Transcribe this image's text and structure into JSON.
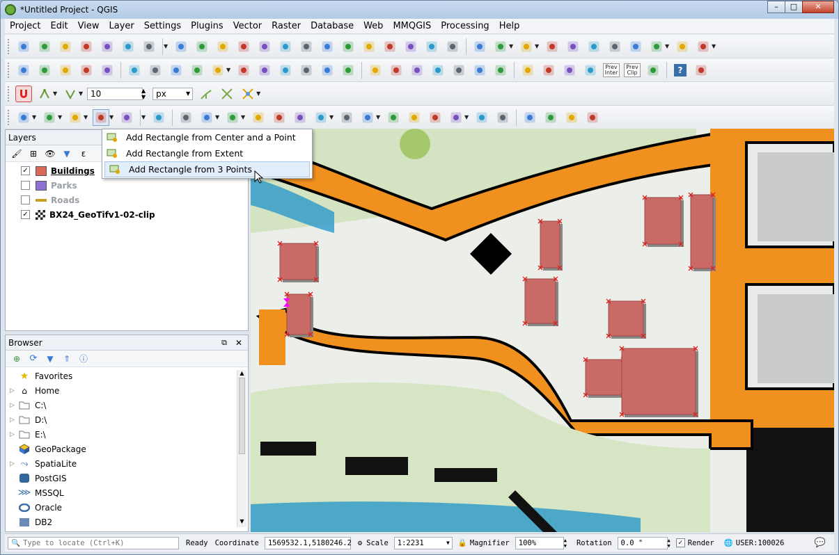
{
  "window": {
    "title": "*Untitled Project - QGIS",
    "minimize": "–",
    "maximize": "□",
    "close": "✕"
  },
  "menu": [
    "Project",
    "Edit",
    "View",
    "Layer",
    "Settings",
    "Plugins",
    "Vector",
    "Raster",
    "Database",
    "Web",
    "MMQGIS",
    "Processing",
    "Help"
  ],
  "toolbar3": {
    "tolerance_value": "10",
    "unit": "px"
  },
  "toolbar1_icons": [
    "new-project",
    "open-project",
    "save-project",
    "save-as",
    "new-print-layout",
    "layout-manager",
    "style-manager",
    "pan",
    "pan-to-selection",
    "zoom-in",
    "zoom-out",
    "zoom-native",
    "zoom-full",
    "zoom-to-selection",
    "zoom-to-layer",
    "zoom-last",
    "zoom-next",
    "new-map-view",
    "new-bookmark",
    "show-bookmarks",
    "refresh",
    "identify",
    "map-tips",
    "select-features",
    "select-by-value",
    "deselect",
    "attribute-table",
    "statistics",
    "field-calculator",
    "measure",
    "annotation",
    "text-annotation"
  ],
  "toolbar2_icons": [
    "data-source-manager",
    "new-geopackage-layer",
    "digitize",
    "current-edits",
    "toggle-editing",
    "save-layer-edits",
    "add-feature",
    "move-feature",
    "vertex-tool",
    "modify-attributes",
    "delete-selected",
    "cut-features",
    "copy-features",
    "paste-features",
    "undo",
    "redo",
    "label-tool",
    "pin-labels",
    "highlight-pinned",
    "move-label",
    "rotate-label",
    "change-label",
    "show-hide-labels",
    "lifebuoy",
    "tracking",
    "python-console",
    "styling",
    "prev-inter",
    "prev-clip",
    "printer",
    "help",
    "crs"
  ],
  "prev_inter_label": "Prev Inter",
  "prev_clip_label": "Prev Clip",
  "toolbar4_icons": [
    "add-circular-string",
    "add-circle",
    "add-ellipse",
    "add-rectangle",
    "add-regular-polygon",
    "digitize-georef",
    "add-ring",
    "add-part",
    "fill-ring",
    "delete-ring",
    "delete-part",
    "reshape",
    "offset-curve",
    "split-features",
    "split-parts",
    "merge-features",
    "merge-attributes",
    "rotate-point-symbols",
    "offset-point-symbols",
    "simplify",
    "curve-j",
    "curve-d",
    "curve-j2",
    "move",
    "bezier"
  ],
  "popup": {
    "items": [
      {
        "label": "Add Rectangle from Center and a Point"
      },
      {
        "label": "Add Rectangle from Extent"
      },
      {
        "label": "Add Rectangle from 3 Points"
      }
    ]
  },
  "layers_panel": {
    "title": "Layers",
    "layers": [
      {
        "name": "Buildings",
        "checked": true,
        "color": "#d9685a",
        "bold": true,
        "underline": true,
        "enabled": true
      },
      {
        "name": "Parks",
        "checked": false,
        "color": "#8e6fd6",
        "bold": true,
        "underline": false,
        "enabled": false
      },
      {
        "name": "Roads",
        "checked": false,
        "color": "#c8a020",
        "bold": true,
        "underline": false,
        "enabled": false
      },
      {
        "name": "BX24_GeoTifv1-02-clip",
        "checked": true,
        "color": "#3a6ea8",
        "bold": true,
        "underline": false,
        "enabled": true
      }
    ]
  },
  "browser_panel": {
    "title": "Browser",
    "float_icon": "⧉",
    "close_icon": "✕",
    "items": [
      {
        "name": "Favorites",
        "icon": "star-icon",
        "arrow": false
      },
      {
        "name": "Home",
        "icon": "home-icon",
        "arrow": true
      },
      {
        "name": "C:\\",
        "icon": "folder-icon",
        "arrow": true
      },
      {
        "name": "D:\\",
        "icon": "folder-icon",
        "arrow": true
      },
      {
        "name": "E:\\",
        "icon": "folder-icon",
        "arrow": true
      },
      {
        "name": "GeoPackage",
        "icon": "geopackage-icon",
        "arrow": false
      },
      {
        "name": "SpatiaLite",
        "icon": "spatialite-icon",
        "arrow": true
      },
      {
        "name": "PostGIS",
        "icon": "postgis-icon",
        "arrow": false
      },
      {
        "name": "MSSQL",
        "icon": "mssql-icon",
        "arrow": false
      },
      {
        "name": "Oracle",
        "icon": "oracle-icon",
        "arrow": false
      },
      {
        "name": "DB2",
        "icon": "db2-icon",
        "arrow": false
      }
    ]
  },
  "status": {
    "locate_placeholder": "Type to locate (Ctrl+K)",
    "ready": "Ready",
    "coordinate_label": "Coordinate",
    "coordinate_value": "1569532.1,5180246.2",
    "scale_label": "Scale",
    "scale_value": "1:2231",
    "magnifier_label": "Magnifier",
    "magnifier_value": "100%",
    "rotation_label": "Rotation",
    "rotation_value": "0.0 °",
    "render_label": "Render",
    "crs": "USER:100026"
  },
  "colors": {
    "road": "#f0901e",
    "building": "#c96a66",
    "vertex": "#e0201a",
    "park": "#cfe1bd",
    "water": "#2c9ac9",
    "cursor_marker": "#ff00ff"
  }
}
